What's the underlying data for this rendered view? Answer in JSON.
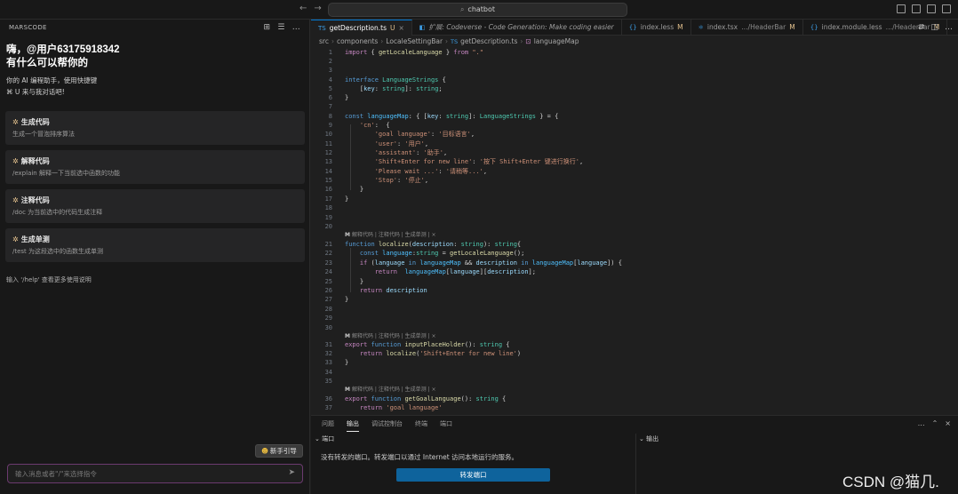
{
  "titlebar": {
    "back_icon": "arrow-left-icon",
    "forward_icon": "arrow-right-icon",
    "search_text": "chatbot"
  },
  "chat": {
    "header_title": "MARSCODE",
    "greeting_line1": "嗨，@用户63175918342",
    "greeting_line2": "有什么可以帮你的",
    "intro_line1": "你的 AI 编程助手，使用快捷键",
    "intro_line2": "⌘ U 来与我对话吧!",
    "cards": [
      {
        "title": "生成代码",
        "desc": "生成一个冒泡排序算法"
      },
      {
        "title": "解释代码",
        "desc": "/explain 解释一下当前选中函数的功能"
      },
      {
        "title": "注释代码",
        "desc": "/doc 为当前选中的代码生成注释"
      },
      {
        "title": "生成单测",
        "desc": "/test 为这段选中的函数生成单测"
      }
    ],
    "help_tip": "输入 '/help' 查看更多使用说明",
    "guide_button": "新手引导",
    "input_placeholder": "输入消息或者\"/\"来选择指令"
  },
  "tabs": [
    {
      "label": "getDescription.ts",
      "suffix": "U",
      "active": true,
      "icon": "TS"
    },
    {
      "label": "扩展: Codeverse - Code Generation: Make coding easier",
      "suffix": "",
      "active": false,
      "preview": true,
      "icon": "◧"
    },
    {
      "label": "index.less",
      "suffix": "M",
      "active": false,
      "icon": "{}"
    },
    {
      "label": "index.tsx",
      "middle": "…/HeaderBar",
      "suffix": "M",
      "active": false,
      "icon": "⚛"
    },
    {
      "label": "index.module.less",
      "middle": "…/HeaderBar",
      "suffix": "M",
      "active": false,
      "icon": "{}"
    }
  ],
  "breadcrumb": [
    "src",
    "components",
    "LocaleSettingBar",
    "getDescription.ts",
    "languageMap"
  ],
  "codelens": {
    "text": "解释代码 | 注释代码 | 生成单测 | ×",
    "logo": "M"
  },
  "panel": {
    "tabs": [
      "问题",
      "输出",
      "调试控制台",
      "终端",
      "端口"
    ],
    "active_tab": "输出",
    "ports_section": "端口",
    "output_section": "输出",
    "no_ports_msg": "没有转发的端口。转发端口以通过 Internet 访问本地运行的服务。",
    "forward_button": "转发端口"
  },
  "watermark": "CSDN @猫几."
}
